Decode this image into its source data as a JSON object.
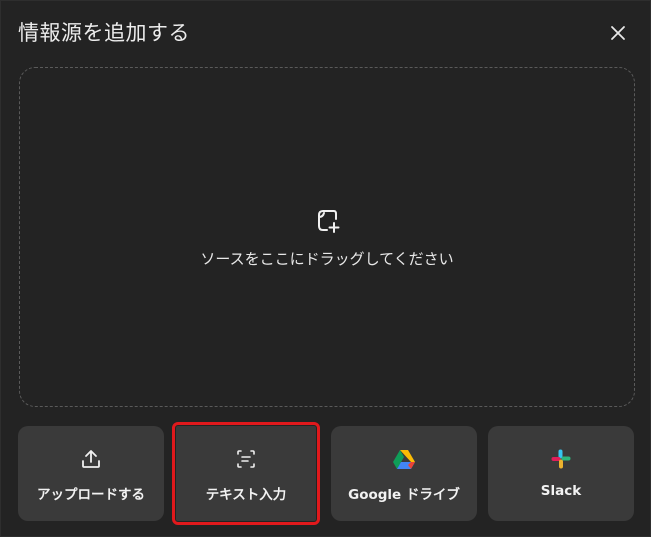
{
  "dialog": {
    "title": "情報源を追加する",
    "close_icon": "close-icon"
  },
  "dropzone": {
    "icon": "add-source-icon",
    "text": "ソースをここにドラッグしてください"
  },
  "buttons": [
    {
      "label": "アップロードする",
      "icon": "upload-icon"
    },
    {
      "label": "テキスト入力",
      "icon": "text-input-icon"
    },
    {
      "label": "Google ドライブ",
      "icon": "google-drive-icon"
    },
    {
      "label": "Slack",
      "icon": "slack-icon"
    }
  ],
  "colors": {
    "background": "#232323",
    "button_bg": "#3a3a3a",
    "highlight": "#e0191c"
  }
}
